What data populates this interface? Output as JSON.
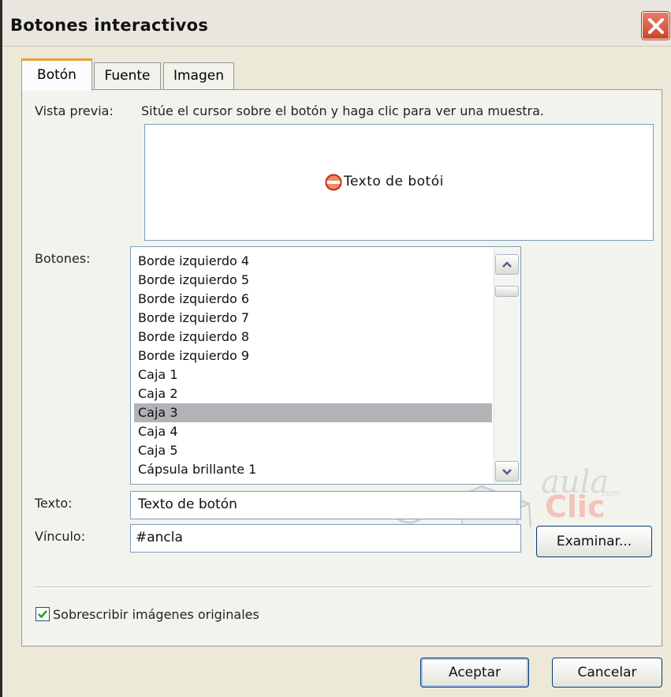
{
  "window": {
    "title": "Botones interactivos"
  },
  "tabs": [
    {
      "label": "Botón",
      "active": true
    },
    {
      "label": "Fuente",
      "active": false
    },
    {
      "label": "Imagen",
      "active": false
    }
  ],
  "preview": {
    "label": "Vista previa:",
    "hint": "Sitúe el cursor sobre el botón y haga clic para ver una muestra.",
    "sample_text": "Texto de botói"
  },
  "buttons_list": {
    "label": "Botones:",
    "items": [
      "Borde izquierdo 4",
      "Borde izquierdo 5",
      "Borde izquierdo 6",
      "Borde izquierdo 7",
      "Borde izquierdo 8",
      "Borde izquierdo 9",
      "Caja 1",
      "Caja 2",
      "Caja 3",
      "Caja 4",
      "Caja 5",
      "Cápsula brillante 1"
    ],
    "selected": "Caja 3"
  },
  "text_field": {
    "label": "Texto:",
    "value": "Texto de botón"
  },
  "link_field": {
    "label": "Vínculo:",
    "value": "#ancla"
  },
  "browse_button": "Examinar...",
  "watermark": {
    "brand_top": "aula",
    "brand_bottom": "Clic",
    "suffix": "com"
  },
  "overwrite": {
    "label": "Sobrescribir imágenes originales",
    "checked": true
  },
  "footer": {
    "ok": "Aceptar",
    "cancel": "Cancelar"
  },
  "colors": {
    "active_tab_accent": "#e6a230",
    "close_button": "#c8452a",
    "selection": "#b2b2b7"
  }
}
